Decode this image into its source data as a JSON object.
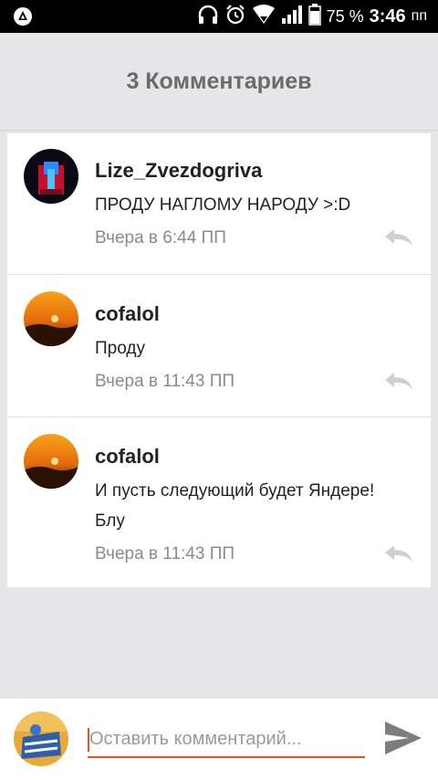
{
  "status_bar": {
    "battery_percent": "75 %",
    "time": "3:46",
    "ampm": "пп",
    "icons": [
      "notification-icon",
      "headphones-icon",
      "alarm-icon",
      "wifi-icon",
      "signal-icon",
      "battery-icon"
    ]
  },
  "header": {
    "title": "3 Комментариев"
  },
  "comments": [
    {
      "username": "Lize_Zvezdogriva",
      "text": "ПРОДУ НАГЛОМУ НАРОДУ >:D",
      "time": "Вчера в 6:44 ПП"
    },
    {
      "username": "cofalol",
      "text": "Проду",
      "time": "Вчера в 11:43 ПП"
    },
    {
      "username": "cofalol",
      "text_line1": "И пусть следующий будет Яндере!",
      "text_line2": "Блу",
      "time": "Вчера в 11:43 ПП"
    }
  ],
  "composer": {
    "placeholder": "Оставить комментарий..."
  },
  "colors": {
    "accent": "#e2541e",
    "background": "#e6e6e9",
    "card": "#ffffff",
    "muted": "#8a8a8a"
  }
}
